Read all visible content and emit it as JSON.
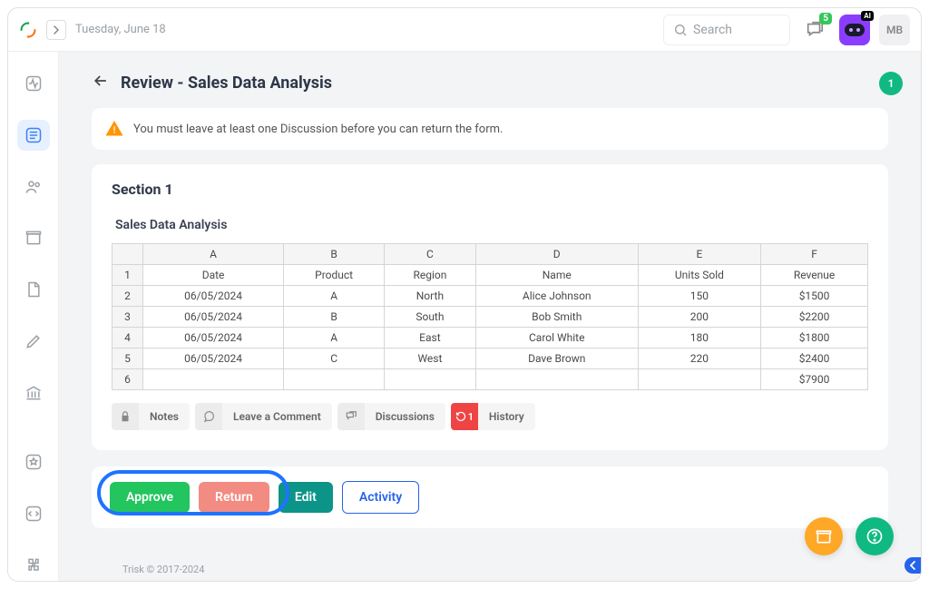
{
  "header": {
    "date": "Tuesday, June 18",
    "search_placeholder": "Search",
    "chat_badge": "5",
    "ai_tag": "AI",
    "avatar_initials": "MB"
  },
  "main": {
    "right_badge": "1",
    "title": "Review - Sales Data Analysis",
    "alert": "You must leave at least one Discussion before you can return the form.",
    "section_title": "Section 1",
    "subtitle": "Sales Data Analysis"
  },
  "table": {
    "cols": [
      "A",
      "B",
      "C",
      "D",
      "E",
      "F"
    ],
    "rows": [
      {
        "n": "1",
        "cells": [
          "Date",
          "Product",
          "Region",
          "Name",
          "Units Sold",
          "Revenue"
        ]
      },
      {
        "n": "2",
        "cells": [
          "06/05/2024",
          "A",
          "North",
          "Alice Johnson",
          "150",
          "$1500"
        ]
      },
      {
        "n": "3",
        "cells": [
          "06/05/2024",
          "B",
          "South",
          "Bob Smith",
          "200",
          "$2200"
        ]
      },
      {
        "n": "4",
        "cells": [
          "06/05/2024",
          "A",
          "East",
          "Carol White",
          "180",
          "$1800"
        ]
      },
      {
        "n": "5",
        "cells": [
          "06/05/2024",
          "C",
          "West",
          "Dave Brown",
          "220",
          "$2400"
        ]
      },
      {
        "n": "6",
        "cells": [
          "",
          "",
          "",
          "",
          "",
          "$7900"
        ]
      }
    ]
  },
  "tabs": [
    {
      "label": "Notes"
    },
    {
      "label": "Leave a Comment"
    },
    {
      "label": "Discussions"
    },
    {
      "label": "History",
      "badge": "1"
    }
  ],
  "actions": {
    "approve": "Approve",
    "return": "Return",
    "edit": "Edit",
    "activity": "Activity"
  },
  "footer": {
    "copyright": "Trisk © 2017-2024"
  }
}
